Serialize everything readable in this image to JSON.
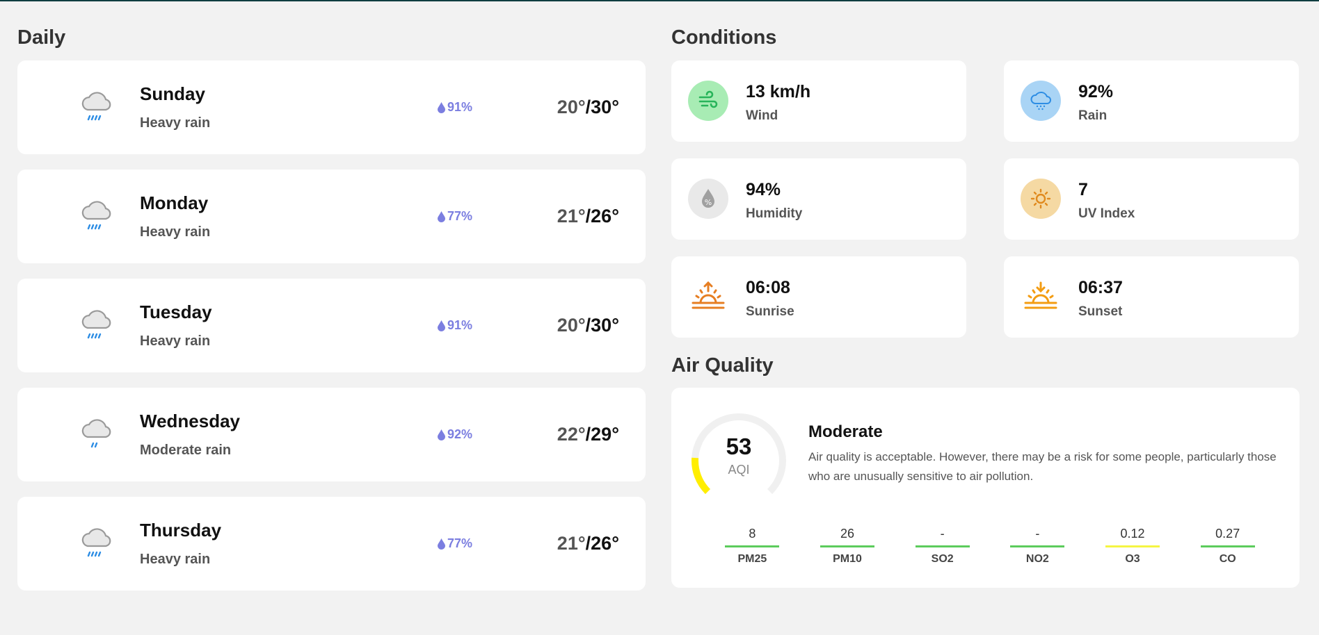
{
  "daily": {
    "title": "Daily",
    "days": [
      {
        "name": "Sunday",
        "condition": "Heavy rain",
        "precip": "91%",
        "low": "20°",
        "high": "30°",
        "icon": "heavy-rain-icon"
      },
      {
        "name": "Monday",
        "condition": "Heavy rain",
        "precip": "77%",
        "low": "21°",
        "high": "26°",
        "icon": "heavy-rain-icon"
      },
      {
        "name": "Tuesday",
        "condition": "Heavy rain",
        "precip": "91%",
        "low": "20°",
        "high": "30°",
        "icon": "heavy-rain-icon"
      },
      {
        "name": "Wednesday",
        "condition": "Moderate rain",
        "precip": "92%",
        "low": "22°",
        "high": "29°",
        "icon": "moderate-rain-icon"
      },
      {
        "name": "Thursday",
        "condition": "Heavy rain",
        "precip": "77%",
        "low": "21°",
        "high": "26°",
        "icon": "heavy-rain-icon"
      }
    ]
  },
  "conditions": {
    "title": "Conditions",
    "items": [
      {
        "value": "13 km/h",
        "label": "Wind",
        "icon": "wind-icon",
        "color": "#a8ecb4"
      },
      {
        "value": "92%",
        "label": "Rain",
        "icon": "rain-cloud-icon",
        "color": "#a9d4f5"
      },
      {
        "value": "94%",
        "label": "Humidity",
        "icon": "humidity-icon",
        "color": "#e9e9e9"
      },
      {
        "value": "7",
        "label": "UV Index",
        "icon": "sun-icon",
        "color": "#f5d9a3"
      },
      {
        "value": "06:08",
        "label": "Sunrise",
        "icon": "sunrise-icon",
        "color": "#e67e22"
      },
      {
        "value": "06:37",
        "label": "Sunset",
        "icon": "sunset-icon",
        "color": "#f39c12"
      }
    ]
  },
  "air_quality": {
    "title": "Air Quality",
    "aqi": "53",
    "aqi_label": "AQI",
    "aqi_fraction": 0.18,
    "status": "Moderate",
    "description": "Air quality is acceptable. However, there may be a risk for some people, particularly those who are unusually sensitive to air pollution.",
    "pollutants": [
      {
        "value": "8",
        "name": "PM25",
        "color": "#5ccc5c"
      },
      {
        "value": "26",
        "name": "PM10",
        "color": "#5ccc5c"
      },
      {
        "value": "-",
        "name": "SO2",
        "color": "#5ccc5c"
      },
      {
        "value": "-",
        "name": "NO2",
        "color": "#5ccc5c"
      },
      {
        "value": "0.12",
        "name": "O3",
        "color": "#f5f542"
      },
      {
        "value": "0.27",
        "name": "CO",
        "color": "#5ccc5c"
      }
    ],
    "gauge_color": "#ffee00"
  }
}
